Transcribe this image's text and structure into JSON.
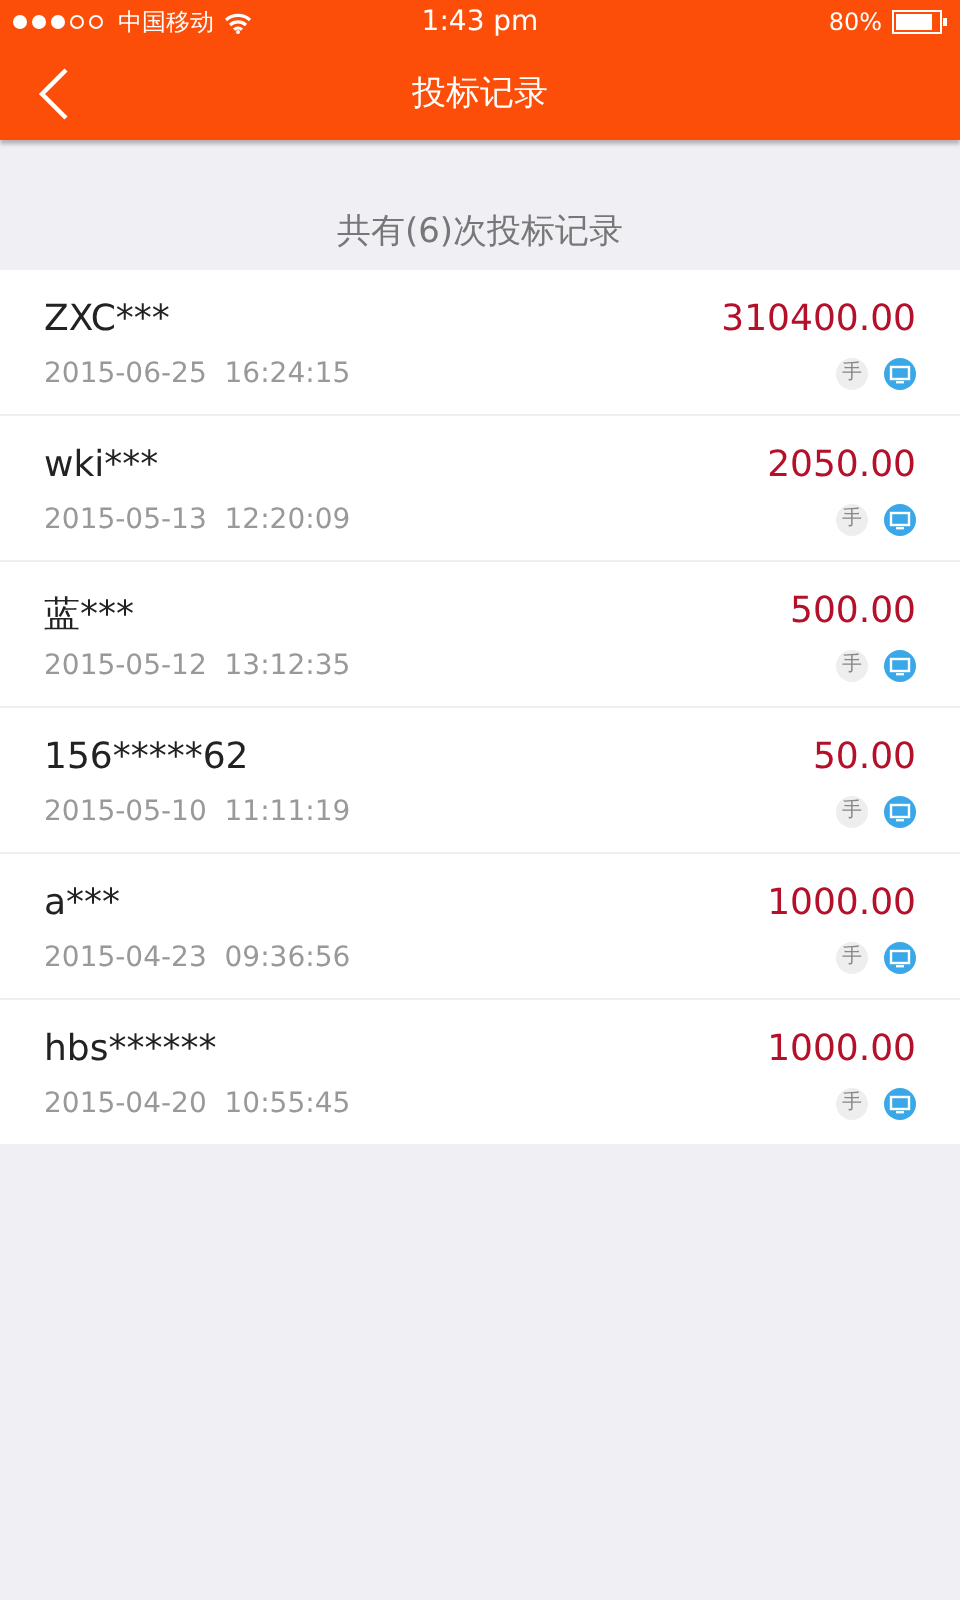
{
  "status_bar": {
    "carrier": "中国移动",
    "time": "1:43 pm",
    "battery": "80%"
  },
  "nav": {
    "title": "投标记录"
  },
  "summary": "共有(6)次投标记录",
  "records": [
    {
      "user": "ZXC***",
      "datetime": "2015-06-25  16:24:15",
      "amount": "310400.00",
      "badge": "手"
    },
    {
      "user": "wki***",
      "datetime": "2015-05-13  12:20:09",
      "amount": "2050.00",
      "badge": "手"
    },
    {
      "user": "蓝***",
      "datetime": "2015-05-12  13:12:35",
      "amount": "500.00",
      "badge": "手"
    },
    {
      "user": "156*****62",
      "datetime": "2015-05-10  11:11:19",
      "amount": "50.00",
      "badge": "手"
    },
    {
      "user": "a***",
      "datetime": "2015-04-23  09:36:56",
      "amount": "1000.00",
      "badge": "手"
    },
    {
      "user": "hbs******",
      "datetime": "2015-04-20  10:55:45",
      "amount": "1000.00",
      "badge": "手"
    }
  ]
}
